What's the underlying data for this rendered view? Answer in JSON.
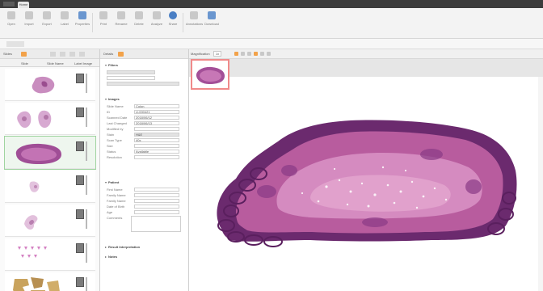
{
  "window": {
    "tab_label": "Home"
  },
  "ribbon": {
    "buttons": [
      "Open",
      "Import",
      "Export",
      "Label",
      "Properties",
      "Print",
      "Rename",
      "Delete",
      "Analyze",
      "Share",
      "Help",
      "Annotations",
      "Download"
    ]
  },
  "slides_panel": {
    "title": "Slides",
    "columns": {
      "preview": "Slide",
      "name": "Slide Name",
      "label": "Label Image"
    }
  },
  "properties_panel": {
    "title": "Details",
    "sections": {
      "filters": "Filters",
      "images": "Images",
      "patient": "Patient",
      "results": "Result Interpretation",
      "notes": "Notes"
    },
    "image_fields": [
      {
        "label": "Slide Name",
        "value": "Colon"
      },
      {
        "label": "ID",
        "value": "U-000421"
      },
      {
        "label": "Scanned Date",
        "value": "2018/06/12"
      },
      {
        "label": "Last Changed",
        "value": "2018/06/13"
      },
      {
        "label": "Modified by",
        "value": ""
      },
      {
        "label": "Stain",
        "value": "H&E"
      },
      {
        "label": "Scan Type",
        "value": "40x"
      },
      {
        "label": "Size",
        "value": ""
      },
      {
        "label": "Status",
        "value": "Available"
      },
      {
        "label": "Resolution",
        "value": ""
      }
    ],
    "patient_fields": [
      {
        "label": "First Name",
        "value": ""
      },
      {
        "label": "Family Name",
        "value": ""
      },
      {
        "label": "Family Name",
        "value": ""
      },
      {
        "label": "Date of Birth",
        "value": ""
      },
      {
        "label": "Age",
        "value": ""
      },
      {
        "label": "Comments",
        "value": ""
      }
    ]
  },
  "viewer": {
    "title": "Magnification",
    "zoom": "1x"
  },
  "colors": {
    "tissue_dark": "#6b2a6e",
    "tissue_mid": "#b85c9e",
    "tissue_light": "#e1a1cc",
    "selection": "#f08a8a",
    "accent": "#f2a24a",
    "app_bar": "#3c3c3c"
  }
}
